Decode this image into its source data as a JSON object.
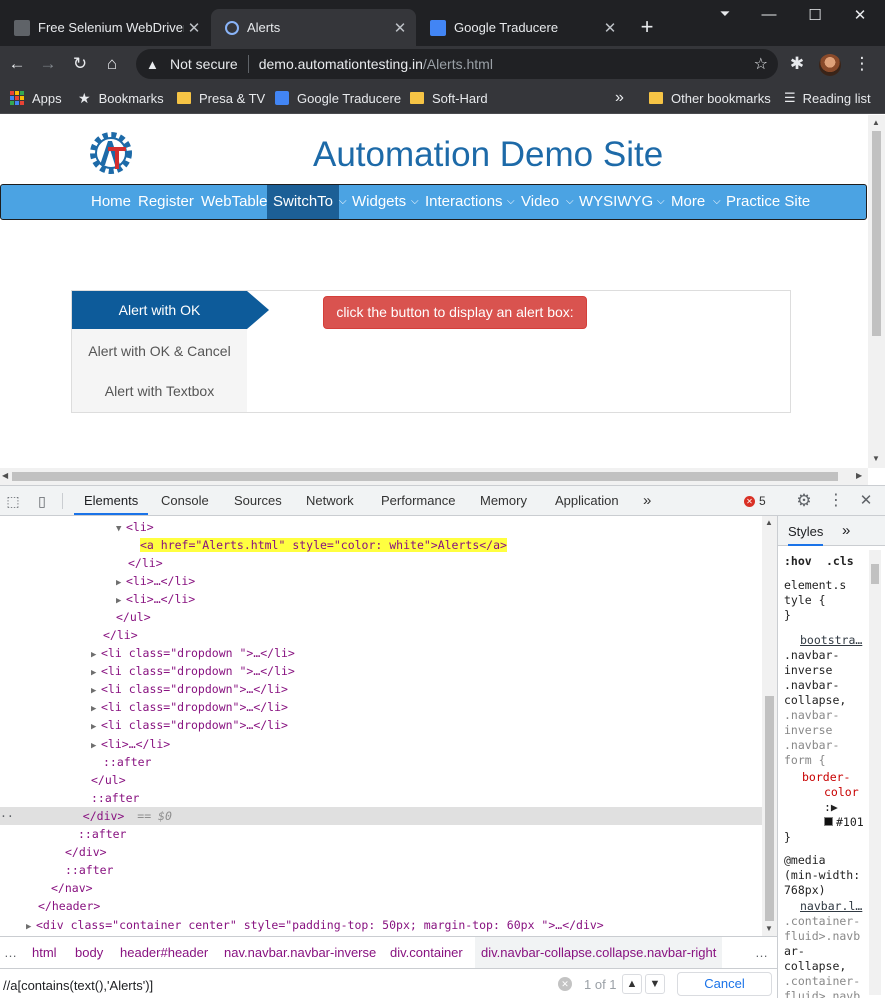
{
  "tabs": [
    {
      "title": "Free Selenium WebDriver C",
      "favicon_color": "#5f6368"
    },
    {
      "title": "Alerts",
      "favicon_color": "#e8eaed"
    },
    {
      "title": "Google Traducere",
      "favicon_color": "#4285f4"
    }
  ],
  "address": {
    "security_label": "Not secure",
    "host": "demo.automationtesting.in",
    "path": "/Alerts.html"
  },
  "bookmarks": {
    "items": [
      "Apps",
      "Bookmarks",
      "Presa & TV",
      "Google Traducere",
      "Soft-Hard"
    ],
    "overflow": "»",
    "other": "Other bookmarks",
    "reading_list": "Reading list"
  },
  "site": {
    "title": "Automation Demo Site",
    "brand_color": "#1d6aa8",
    "nav": [
      "Home",
      "Register",
      "WebTable",
      "SwitchTo",
      "Widgets",
      "Interactions",
      "Video",
      "WYSIWYG",
      "More",
      "Practice Site"
    ],
    "alert_tabs": [
      "Alert with OK",
      "Alert with OK & Cancel",
      "Alert with Textbox"
    ],
    "alert_button": "click the button to display an alert box:"
  },
  "devtools": {
    "tabs": [
      "Elements",
      "Console",
      "Sources",
      "Network",
      "Performance",
      "Memory",
      "Application",
      "»"
    ],
    "error_count": "5",
    "dom": {
      "l1": "<li>",
      "l2_open": "<a href=\"Alerts.html\" style=\"color: white\">Alerts</a>",
      "l3": "</li>",
      "l4": "<li>…</li>",
      "l5": "<li>…</li>",
      "l6": "</ul>",
      "l7": "</li>",
      "dd1": "<li class=\"dropdown \">…</li>",
      "dd2": "<li class=\"dropdown \">…</li>",
      "dd3": "<li class=\"dropdown\">…</li>",
      "dd4": "<li class=\"dropdown\">…</li>",
      "dd5": "<li class=\"dropdown\">…</li>",
      "l13": "<li>…</li>",
      "after1": "::after",
      "ul_close": "</ul>",
      "after2": "::after",
      "div_close": "</div>",
      "sel_marker": "== $0",
      "after3": "::after",
      "div_close2": "</div>",
      "after4": "::after",
      "nav_close": "</nav>",
      "header_close": "</header>",
      "last": "<div class=\"container center\" style=\"padding-top: 50px; margin-top: 60px \">…</div>"
    },
    "styles": {
      "tab": "Styles",
      "more": "»",
      "hov": ":hov",
      "cls": ".cls",
      "element_style": [
        "element.s",
        "tyle {",
        "}"
      ],
      "source1": "bootstra…",
      "rule1": [
        ".navbar-",
        "inverse",
        ".navbar-",
        "collapse,",
        ".navbar-",
        "inverse",
        ".navbar-",
        "form {"
      ],
      "prop1": [
        "border-",
        "color"
      ],
      "value1": "#101",
      "close1": "}",
      "media": [
        "@media",
        "(min-width:",
        "768px)"
      ],
      "source2": "navbar.l…",
      "rule2": [
        ".container-",
        "fluid>.navb",
        "ar-",
        "collapse,",
        ".container-",
        "fluid>.navb"
      ]
    },
    "breadcrumbs": [
      "html",
      "body",
      "header#header",
      "nav.navbar.navbar-inverse",
      "div.container",
      "div.navbar-collapse.collapse.navbar-right"
    ],
    "search": {
      "value": "//a[contains(text(),'Alerts')]",
      "count": "1 of 1",
      "cancel": "Cancel"
    }
  }
}
